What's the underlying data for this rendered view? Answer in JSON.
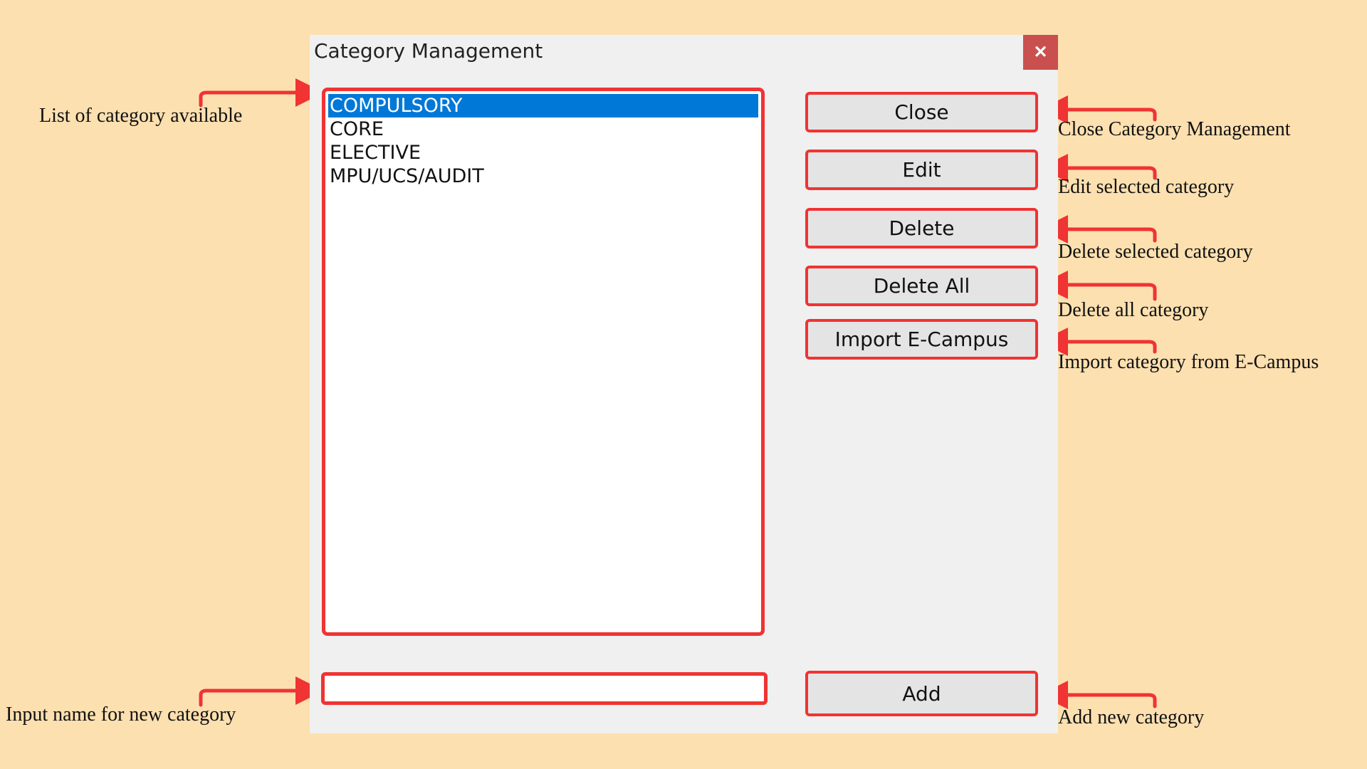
{
  "dialog": {
    "title": "Category Management",
    "close_glyph": "✕"
  },
  "category_list": {
    "items": [
      "COMPULSORY",
      "CORE",
      "ELECTIVE",
      "MPU/UCS/AUDIT"
    ],
    "selected_index": 0
  },
  "new_category_input": {
    "value": ""
  },
  "buttons": {
    "close": "Close",
    "edit": "Edit",
    "delete": "Delete",
    "delete_all": "Delete All",
    "import_ecampus": "Import E-Campus",
    "add": "Add"
  },
  "annotations": {
    "list": "List of category available",
    "input": "Input name for new category",
    "close": "Close Category Management",
    "edit": "Edit selected category",
    "delete": "Delete selected category",
    "delete_all": "Delete all category",
    "import": "Import category from E-Campus",
    "add": "Add new category"
  },
  "colors": {
    "background": "#fde0b0",
    "highlight": "#f03333",
    "selection": "#0078d7",
    "close_button": "#c9504f"
  }
}
